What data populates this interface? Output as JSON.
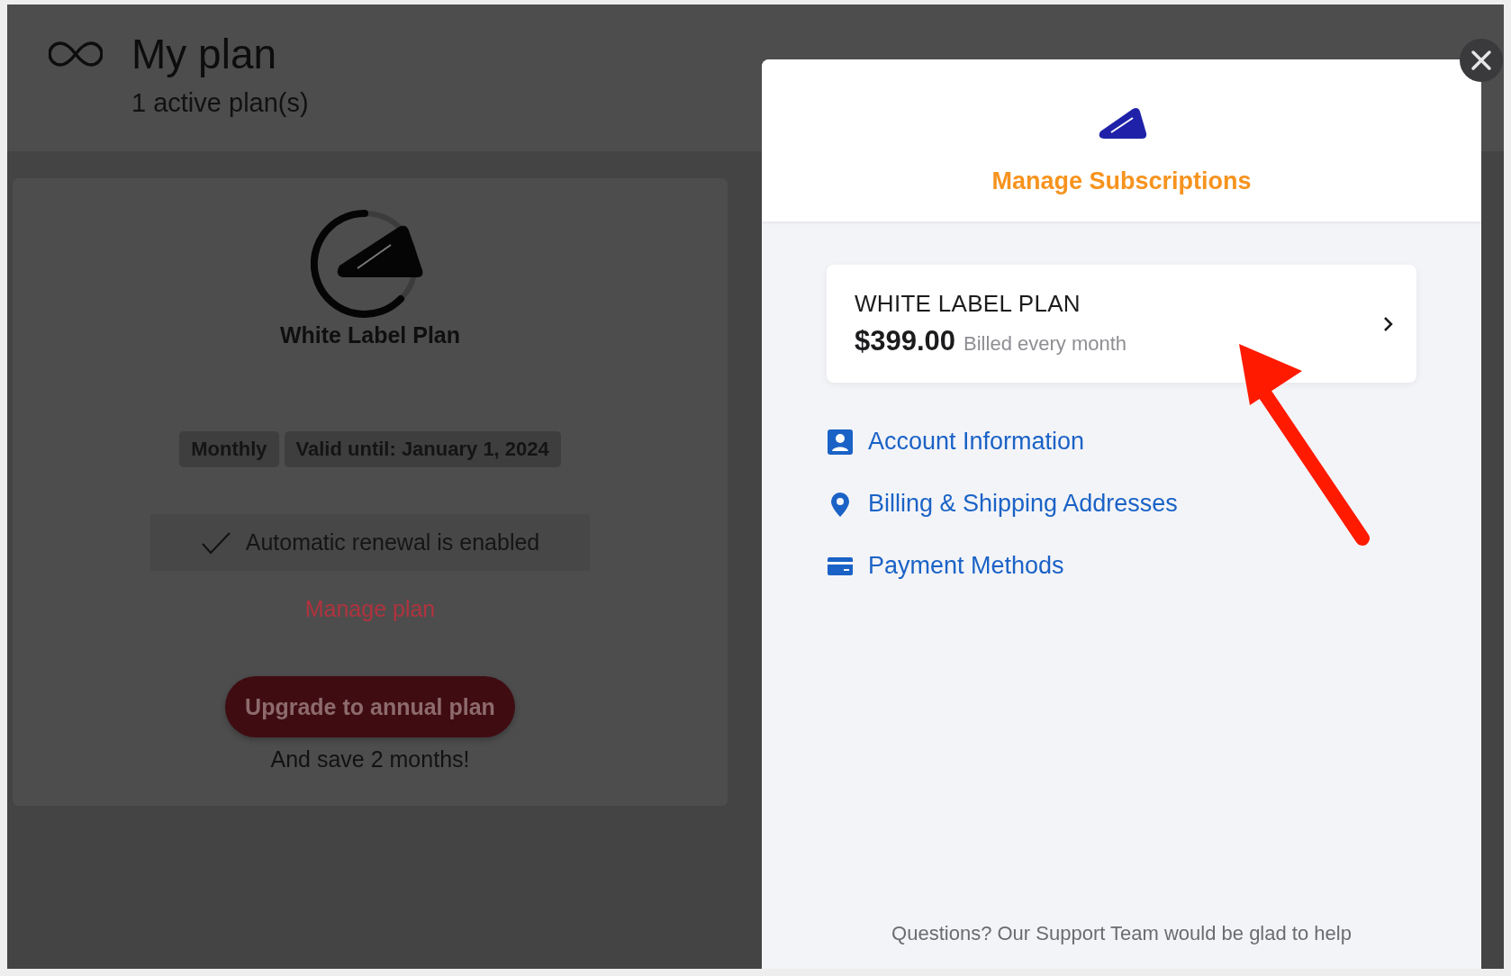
{
  "page": {
    "title": "My plan",
    "subtitle": "1 active plan(s)"
  },
  "plan_card": {
    "name": "White Label Plan",
    "tags": [
      "Monthly",
      "Valid until: January 1, 2024"
    ],
    "auto_renewal": {
      "label": "Automatic renewal is enabled",
      "enabled": true
    },
    "manage_link": "Manage plan",
    "upgrade_button": "Upgrade to annual plan",
    "upgrade_note": "And save 2 months!"
  },
  "modal": {
    "title": "Manage Subscriptions",
    "subscription": {
      "name": "WHITE LABEL PLAN",
      "price": "$399.00",
      "billing": "Billed every month"
    },
    "links": [
      {
        "kind": "account",
        "label": "Account Information"
      },
      {
        "kind": "address",
        "label": "Billing & Shipping Addresses"
      },
      {
        "kind": "payment",
        "label": "Payment Methods"
      }
    ],
    "footer": "Questions? Our Support Team would be glad to help"
  }
}
